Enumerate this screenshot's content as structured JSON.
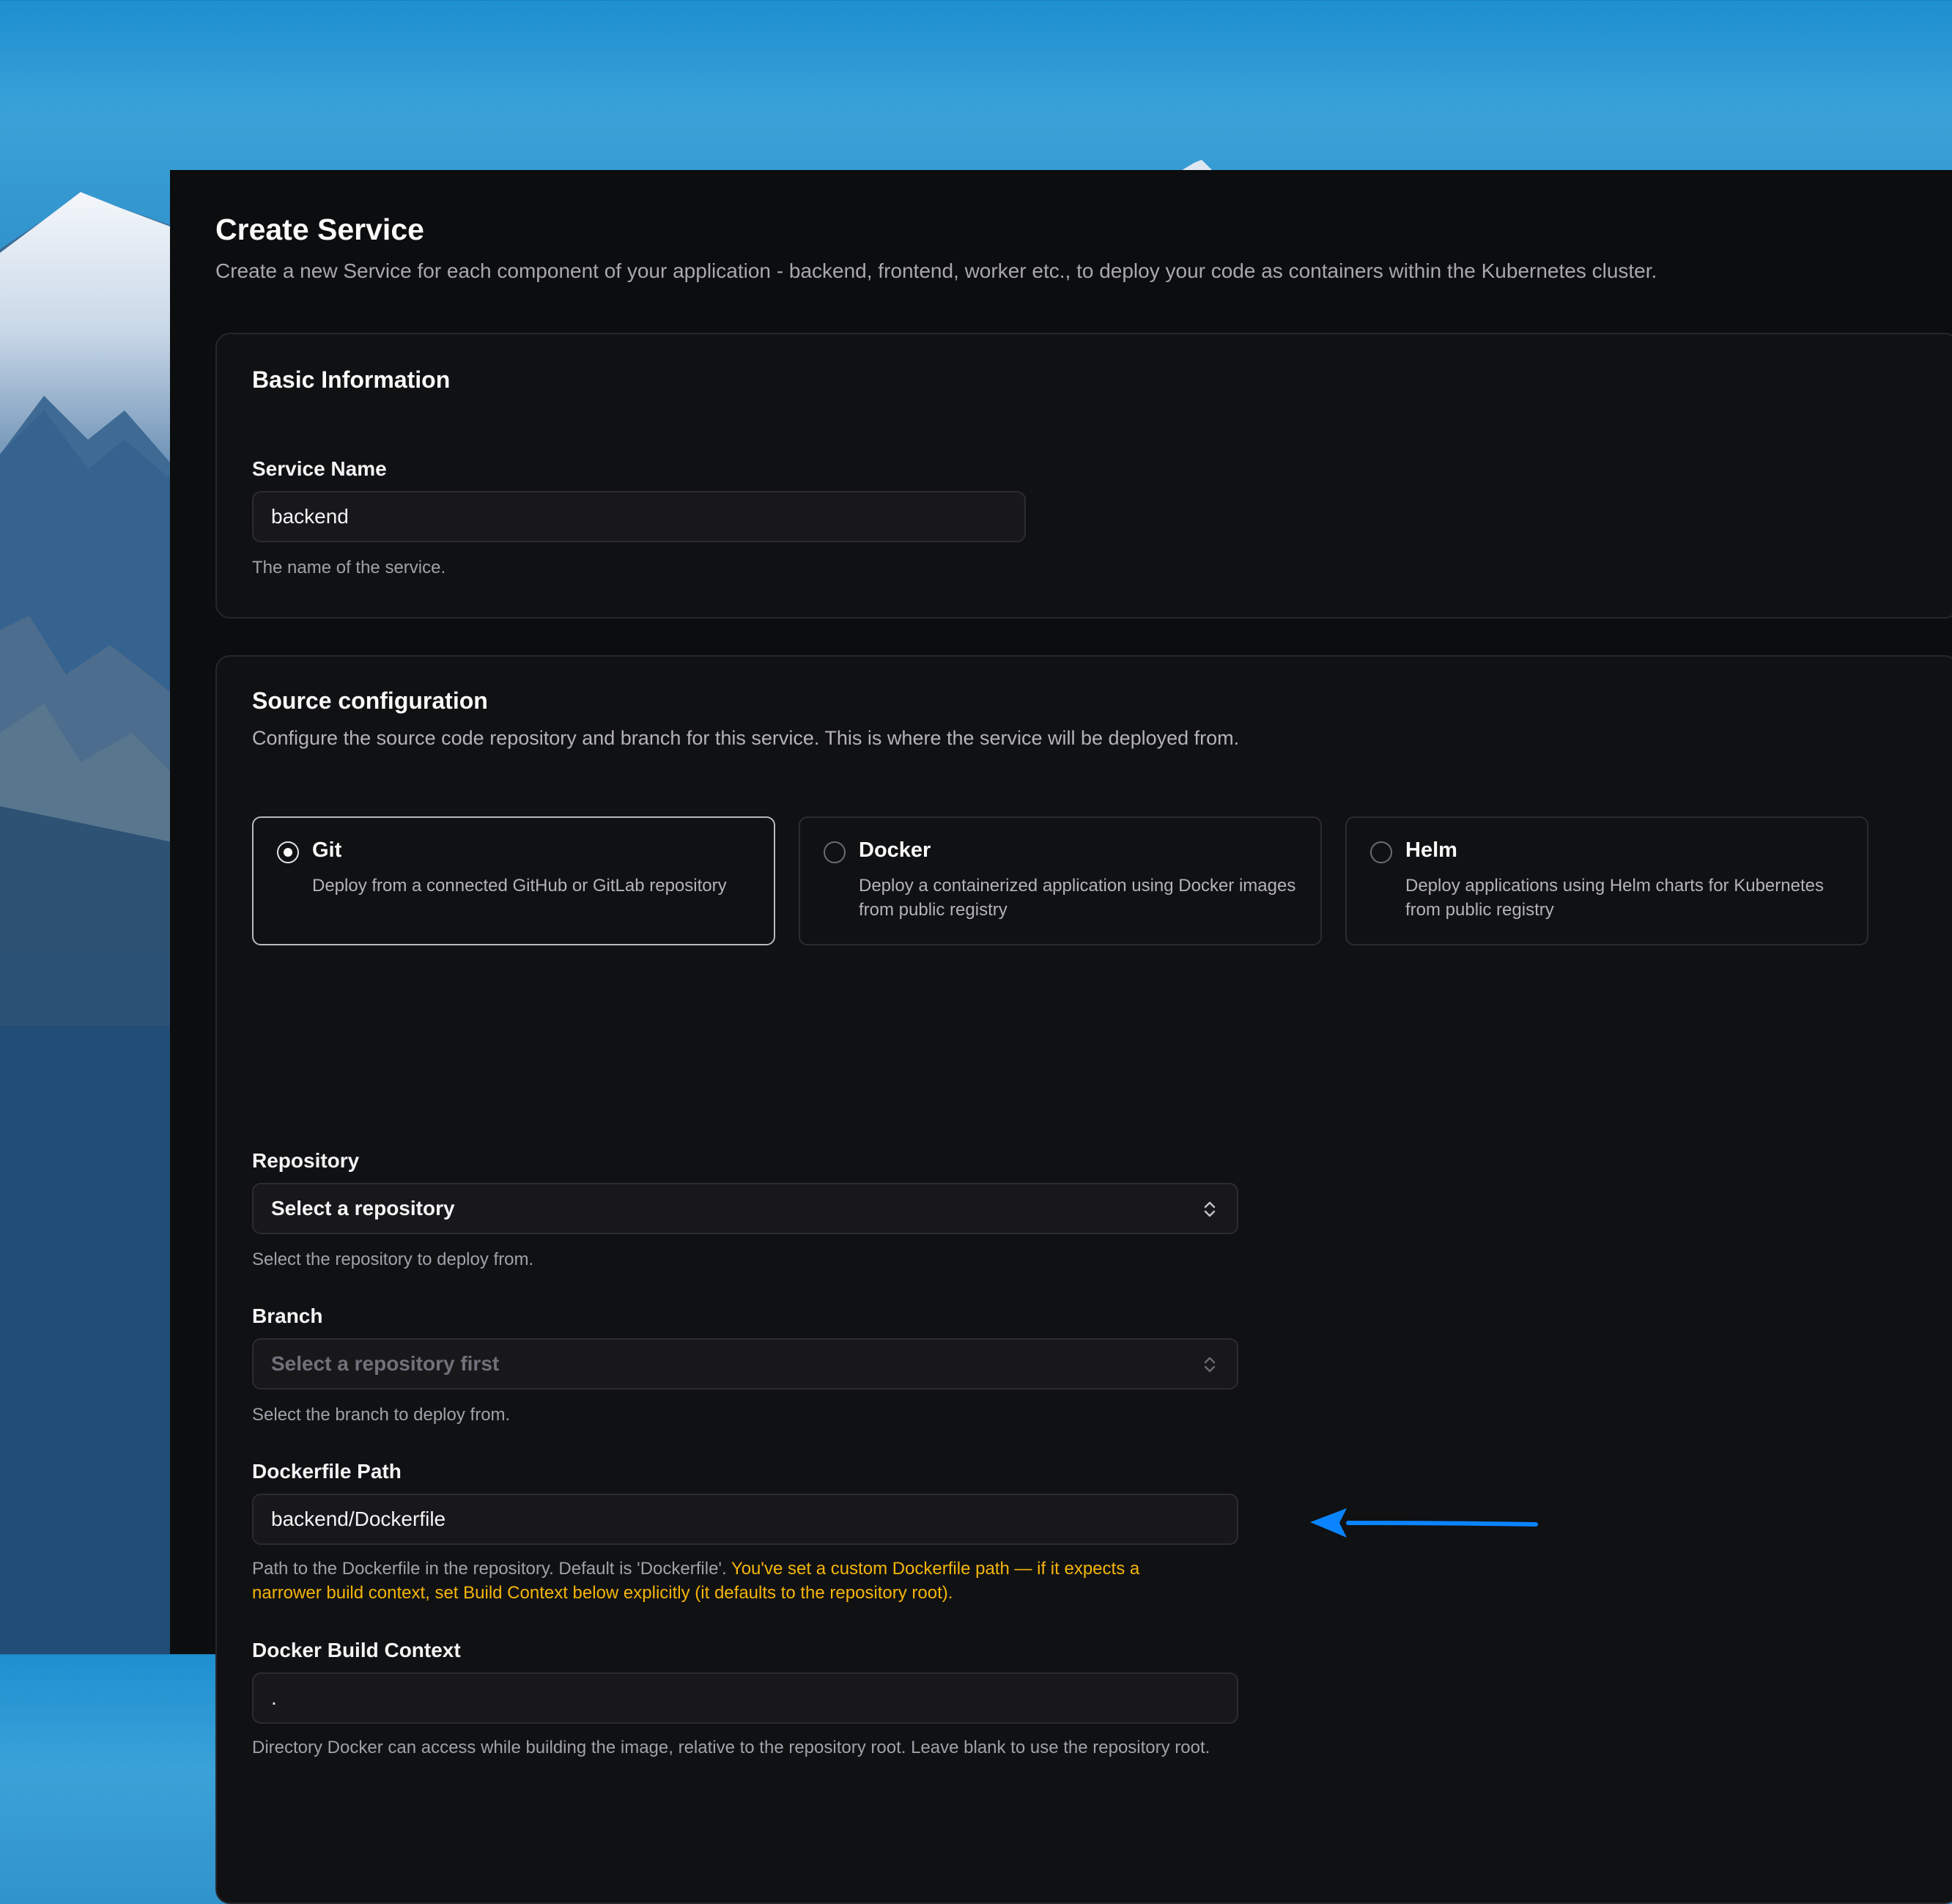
{
  "page": {
    "title": "Create Service",
    "description": "Create a new Service for each component of your application - backend, frontend, worker etc., to deploy your code as containers within the Kubernetes cluster."
  },
  "basic_info": {
    "title": "Basic Information",
    "service_name": {
      "label": "Service Name",
      "value": "backend",
      "hint": "The name of the service."
    }
  },
  "source_config": {
    "title": "Source configuration",
    "description": "Configure the source code repository and branch for this service. This is where the service will be deployed from.",
    "options": [
      {
        "title": "Git",
        "description": "Deploy from a connected GitHub or GitLab repository",
        "selected": true
      },
      {
        "title": "Docker",
        "description": "Deploy a containerized application using Docker images from public registry",
        "selected": false
      },
      {
        "title": "Helm",
        "description": "Deploy applications using Helm charts for Kubernetes from public registry",
        "selected": false
      }
    ],
    "repository": {
      "label": "Repository",
      "value": "Select a repository",
      "hint": "Select the repository to deploy from."
    },
    "branch": {
      "label": "Branch",
      "value": "Select a repository first",
      "hint": "Select the branch to deploy from."
    },
    "dockerfile_path": {
      "label": "Dockerfile Path",
      "value": "backend/Dockerfile",
      "hint": "Path to the Dockerfile in the repository. Default is 'Dockerfile'.",
      "warning": "You've set a custom Dockerfile path — if it expects a narrower build context, set Build Context below explicitly (it defaults to the repository root)."
    },
    "build_context": {
      "label": "Docker Build Context",
      "value": ".",
      "hint": "Directory Docker can access while building the image, relative to the repository root. Leave blank to use the repository root."
    }
  },
  "colors": {
    "panel_bg": "#0c0d0f",
    "card_bg": "#101113",
    "border": "#2c2c30",
    "warning": "#f5b50a",
    "annotation_arrow": "#0a84ff"
  },
  "icons": [
    "radio-selected-icon",
    "radio-icon",
    "chevron-up-down-icon",
    "annotation-arrow-icon"
  ]
}
